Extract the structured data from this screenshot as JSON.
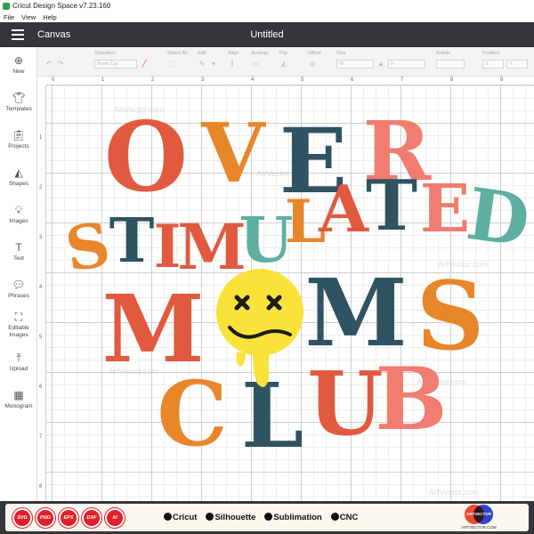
{
  "window": {
    "title": "Cricut Design Space  v7.23.160"
  },
  "menu": [
    "File",
    "View",
    "Help"
  ],
  "header": {
    "section": "Canvas",
    "project_title": "Untitled"
  },
  "toolbar": {
    "operation_label": "Operation",
    "operation_value": "Basic Cut",
    "select_all_label": "Select All",
    "edit_label": "Edit",
    "align_label": "Align",
    "arrange_label": "Arrange",
    "flip_label": "Flip",
    "offset_label": "Offset",
    "size_label": "Size",
    "size_w": "W",
    "size_h": "H",
    "rotate_label": "Rotate",
    "position_label": "Position",
    "position_x": "X",
    "position_y": "Y"
  },
  "sidebar": {
    "items": [
      {
        "label": "New",
        "icon": "plus-circle-icon"
      },
      {
        "label": "Templates",
        "icon": "shirt-icon"
      },
      {
        "label": "Projects",
        "icon": "clipboard-icon"
      },
      {
        "label": "Shapes",
        "icon": "shapes-icon"
      },
      {
        "label": "Images",
        "icon": "lightbulb-icon"
      },
      {
        "label": "Text",
        "icon": "text-icon"
      },
      {
        "label": "Phrases",
        "icon": "speech-bubble-icon"
      },
      {
        "label": "Editable Images",
        "icon": "editable-image-icon"
      },
      {
        "label": "Upload",
        "icon": "upload-icon"
      },
      {
        "label": "Monogram",
        "icon": "monogram-icon"
      }
    ]
  },
  "ruler": {
    "top": [
      "0",
      "1",
      "2",
      "3",
      "4",
      "5",
      "6",
      "7",
      "8",
      "9"
    ],
    "left": [
      "1",
      "2",
      "3",
      "4",
      "5",
      "6",
      "7",
      "8"
    ]
  },
  "watermark": "ArtVector.com",
  "design": {
    "line1": "OVER",
    "line2": "STIMULATED",
    "line3": "MOMS",
    "line4": "CLUB",
    "colors": {
      "red": "#e15a3f",
      "orange": "#e8862a",
      "teal": "#2f5360",
      "pink": "#f07d6f",
      "seafoam": "#5fb0a1",
      "smiley": "#fbe23a"
    }
  },
  "footer": {
    "formats": [
      "SVG",
      "PNG",
      "EPS",
      "DXF",
      "AI"
    ],
    "brands": [
      "Cricut",
      "Silhouette",
      "Sublimation",
      "CNC"
    ],
    "logo_top": "ARTVECTOR",
    "logo_bottom": "ARTVECTOR.COM"
  }
}
